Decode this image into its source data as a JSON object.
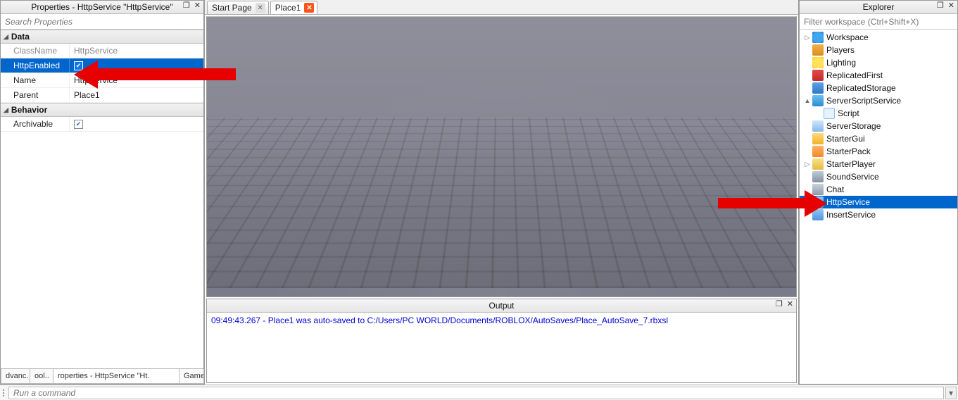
{
  "properties": {
    "title": "Properties - HttpService \"HttpService\"",
    "search_placeholder": "Search Properties",
    "groups": [
      {
        "name": "Data",
        "rows": [
          {
            "name": "ClassName",
            "value": "HttpService",
            "readonly": true,
            "checkbox": false
          },
          {
            "name": "HttpEnabled",
            "value": "",
            "readonly": false,
            "checkbox": true,
            "checked": true,
            "selected": true
          },
          {
            "name": "Name",
            "value": "HttpService",
            "readonly": false,
            "checkbox": false
          },
          {
            "name": "Parent",
            "value": "Place1",
            "readonly": false,
            "checkbox": false
          }
        ]
      },
      {
        "name": "Behavior",
        "rows": [
          {
            "name": "Archivable",
            "value": "",
            "readonly": false,
            "checkbox": true,
            "checked": true
          }
        ]
      }
    ],
    "dock_tabs": [
      {
        "label": "dvanc.",
        "active": false
      },
      {
        "label": "ool..",
        "active": false
      },
      {
        "label": "roperties - HttpService \"Ht.",
        "active": true
      },
      {
        "label": "Game",
        "active": false
      }
    ]
  },
  "document_tabs": [
    {
      "label": "Start Page",
      "active": false,
      "close_style": "grey"
    },
    {
      "label": "Place1",
      "active": true,
      "close_style": "orange"
    }
  ],
  "output": {
    "title": "Output",
    "lines": [
      "09:49:43.267 - Place1 was auto-saved to C:/Users/PC WORLD/Documents/ROBLOX/AutoSaves/Place_AutoSave_7.rbxsl"
    ]
  },
  "explorer": {
    "title": "Explorer",
    "filter_placeholder": "Filter workspace (Ctrl+Shift+X)",
    "nodes": [
      {
        "depth": 0,
        "arrow": "▷",
        "icon": "ic-globe",
        "label": "Workspace"
      },
      {
        "depth": 0,
        "arrow": "",
        "icon": "ic-users",
        "label": "Players"
      },
      {
        "depth": 0,
        "arrow": "",
        "icon": "ic-bulb",
        "label": "Lighting"
      },
      {
        "depth": 0,
        "arrow": "",
        "icon": "ic-box-red",
        "label": "ReplicatedFirst"
      },
      {
        "depth": 0,
        "arrow": "",
        "icon": "ic-box-blue",
        "label": "ReplicatedStorage"
      },
      {
        "depth": 0,
        "arrow": "▲",
        "icon": "ic-gear",
        "label": "ServerScriptService"
      },
      {
        "depth": 1,
        "arrow": "",
        "icon": "ic-script",
        "label": "Script"
      },
      {
        "depth": 0,
        "arrow": "",
        "icon": "ic-cloud",
        "label": "ServerStorage"
      },
      {
        "depth": 0,
        "arrow": "",
        "icon": "ic-folder-y",
        "label": "StarterGui"
      },
      {
        "depth": 0,
        "arrow": "",
        "icon": "ic-folder-o",
        "label": "StarterPack"
      },
      {
        "depth": 0,
        "arrow": "▷",
        "icon": "ic-folder-b",
        "label": "StarterPlayer"
      },
      {
        "depth": 0,
        "arrow": "",
        "icon": "ic-speaker",
        "label": "SoundService"
      },
      {
        "depth": 0,
        "arrow": "",
        "icon": "ic-chat",
        "label": "Chat"
      },
      {
        "depth": 0,
        "arrow": "",
        "icon": "ic-cube",
        "label": "HttpService",
        "selected": true
      },
      {
        "depth": 0,
        "arrow": "",
        "icon": "ic-cube",
        "label": "InsertService"
      }
    ]
  },
  "command_placeholder": "Run a command",
  "close_glyph": "✕",
  "undock_glyph": "❐"
}
